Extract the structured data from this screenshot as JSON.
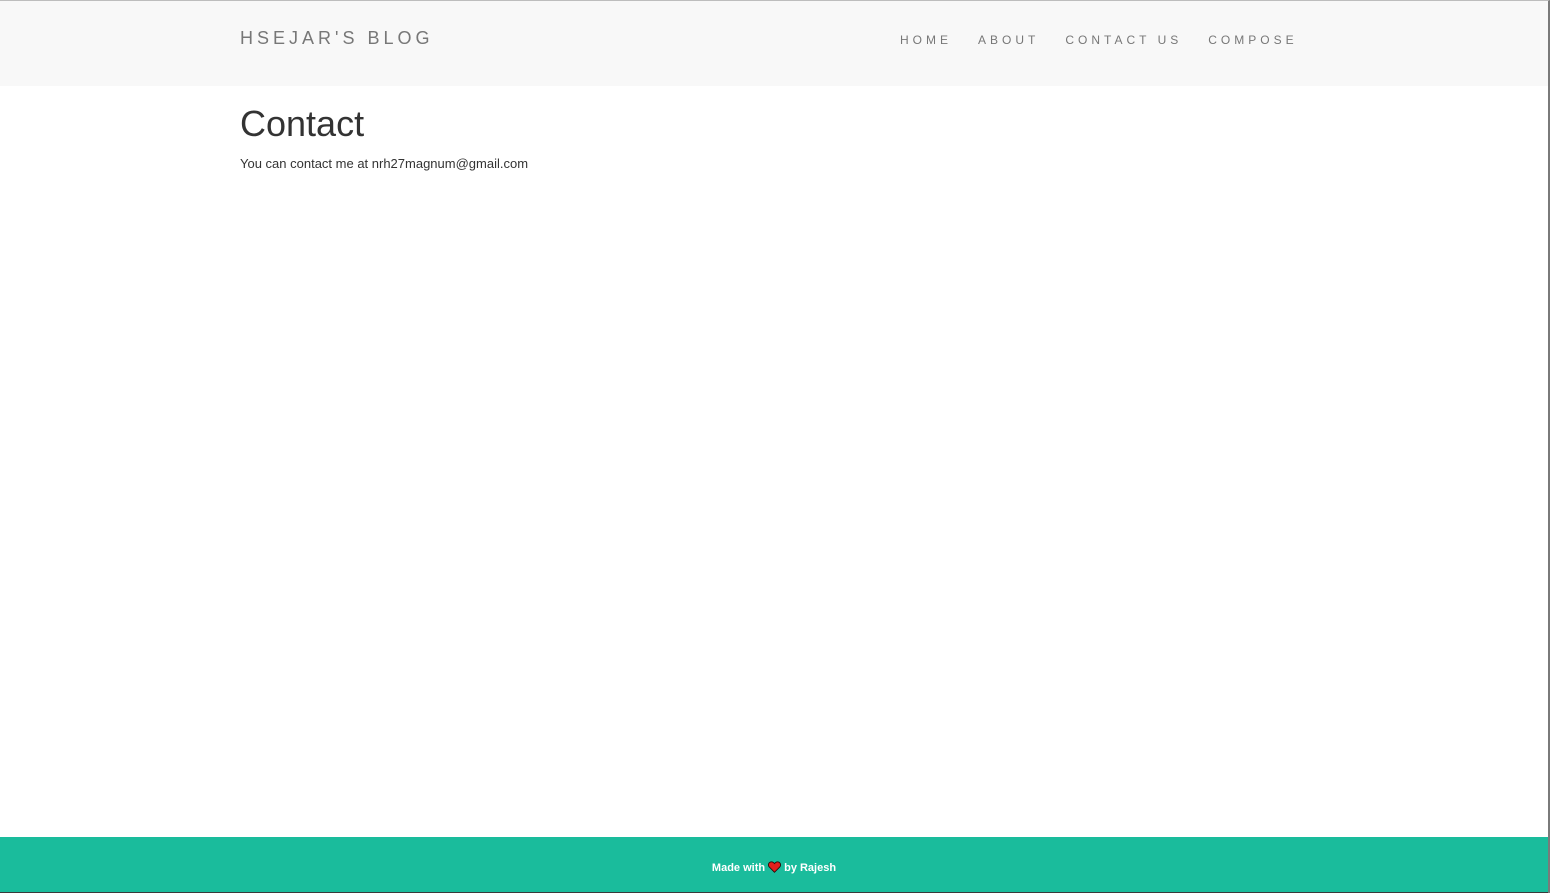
{
  "navbar": {
    "brand": "HSEJAR'S BLOG",
    "links": [
      {
        "label": "HOME"
      },
      {
        "label": "ABOUT"
      },
      {
        "label": "CONTACT US"
      },
      {
        "label": "COMPOSE"
      }
    ]
  },
  "main": {
    "title": "Contact",
    "text": "You can contact me at nrh27magnum@gmail.com"
  },
  "footer": {
    "prefix": "Made with",
    "suffix": "by Rajesh",
    "heart_color": "#e0201c",
    "background_color": "#1abc9c"
  }
}
